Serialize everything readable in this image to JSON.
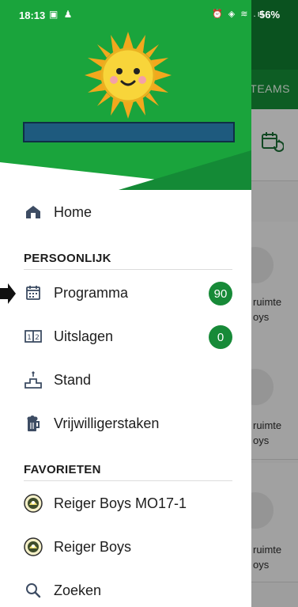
{
  "status": {
    "time": "18:13",
    "battery": "56%"
  },
  "app_behind": {
    "tab_label": "TEAMS",
    "card_texts": [
      [
        "ruimte",
        "oys"
      ],
      [
        "ruimte",
        "oys"
      ],
      [
        "ruimte",
        "oys"
      ]
    ]
  },
  "drawer": {
    "home_label": "Home",
    "sections": {
      "personal_title": "PERSOONLIJK",
      "favorites_title": "FAVORIETEN"
    },
    "personal_items": [
      {
        "label": "Programma",
        "badge": "90",
        "icon": "calendar-icon"
      },
      {
        "label": "Uitslagen",
        "badge": "0",
        "icon": "scoreboard-icon"
      },
      {
        "label": "Stand",
        "icon": "podium-icon"
      },
      {
        "label": "Vrijwilligerstaken",
        "icon": "beer-mug-icon"
      }
    ],
    "favorites": [
      {
        "label": "Reiger Boys MO17-1",
        "icon": "club-logo-icon"
      },
      {
        "label": "Reiger Boys",
        "icon": "club-logo-icon"
      }
    ],
    "search_label": "Zoeken"
  },
  "colors": {
    "brand_green": "#178a38",
    "header_green": "#1aa43c",
    "dark_green": "#0f7a2f"
  }
}
